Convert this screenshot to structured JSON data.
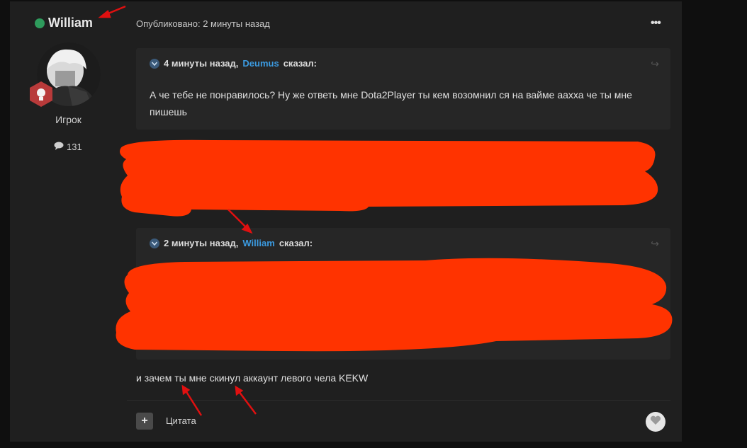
{
  "author": {
    "name": "William",
    "rank": "Игрок",
    "post_count": "131"
  },
  "post": {
    "published": "Опубликовано: 2 минуты назад",
    "menu_label": "•••",
    "reply_text": "и зачем ты мне скинул аккаунт левого чела  KEKW"
  },
  "quote1": {
    "time": "4 минуты назад,",
    "user": "Deumus",
    "said": "сказал:",
    "body": "А че тебе не понравилось? Ну же ответь мне Dota2Player ты кем возомнил ся на вайме аахха че ты мне пишешь"
  },
  "quote2": {
    "time": "2 минуты назад,",
    "user": "William",
    "said": "сказал:"
  },
  "footer": {
    "quote_label": "Цитата"
  },
  "colors": {
    "online": "#2e9b5c",
    "link": "#3b9ae0",
    "redaction": "#ff3300",
    "annotation_arrow": "#e01010"
  }
}
